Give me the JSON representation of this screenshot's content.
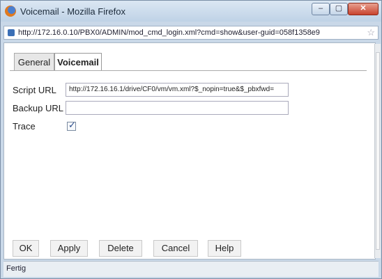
{
  "window": {
    "title": "Voicemail - Mozilla Firefox",
    "min_label": "–",
    "max_label": "▢",
    "close_label": "✕"
  },
  "address_bar": {
    "url": "http://172.16.0.10/PBX0/ADMIN/mod_cmd_login.xml?cmd=show&user-guid=058f1358e9"
  },
  "tabs": [
    {
      "label": "General"
    },
    {
      "label": "Voicemail"
    }
  ],
  "form": {
    "script_url": {
      "label": "Script URL",
      "value": "http://172.16.16.1/drive/CF0/vm/vm.xml?$_nopin=true&$_pbxfwd="
    },
    "backup_url": {
      "label": "Backup URL",
      "value": ""
    },
    "trace": {
      "label": "Trace",
      "checked": true
    }
  },
  "buttons": {
    "ok": "OK",
    "apply": "Apply",
    "delete": "Delete",
    "cancel": "Cancel",
    "help": "Help"
  },
  "status": {
    "text": "Fertig"
  },
  "icons": {
    "app": "firefox-icon",
    "page": "page-icon",
    "bookmark": "star-icon",
    "checkbox": "checkmark-icon"
  }
}
